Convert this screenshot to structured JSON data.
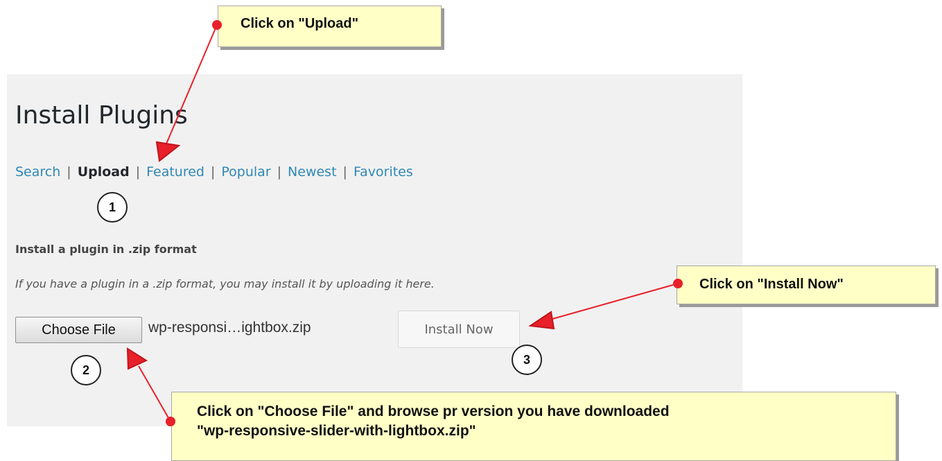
{
  "page": {
    "title": "Install Plugins",
    "tabs": [
      {
        "label": "Search"
      },
      {
        "label": "Upload"
      },
      {
        "label": "Featured"
      },
      {
        "label": "Popular"
      },
      {
        "label": "Newest"
      },
      {
        "label": "Favorites"
      }
    ],
    "separator": "|",
    "active_tab": "Upload",
    "section_heading": "Install a plugin in .zip format",
    "description": "If you have a plugin in a .zip format, you may install it by uploading it here.",
    "choose_file_label": "Choose File",
    "file_name": "wp-responsi…ightbox.zip",
    "install_button_label": "Install Now"
  },
  "annotations": {
    "callout_upload": "Click on \"Upload\"",
    "callout_install": "Click on \"Install Now\"",
    "callout_choose_line1": "Click on \"Choose File\" and browse pr version you have downloaded",
    "callout_choose_line2": "\"wp-responsive-slider-with-lightbox.zip\"",
    "step1": "1",
    "step2": "2",
    "step3": "3"
  },
  "colors": {
    "panel_background": "#f1f1f1",
    "link": "#2e88b5",
    "callout_fill": "#ffffc6",
    "arrow": "#e8202a"
  }
}
